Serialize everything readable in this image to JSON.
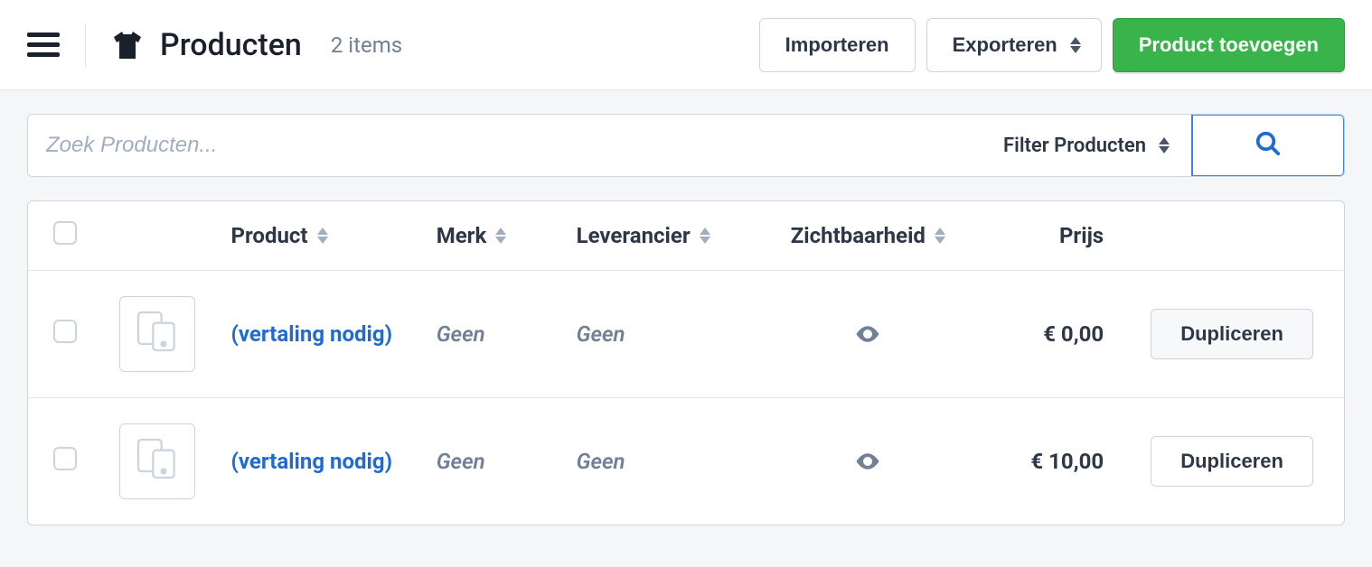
{
  "header": {
    "title": "Producten",
    "count_label": "2 items",
    "import_label": "Importeren",
    "export_label": "Exporteren",
    "add_product_label": "Product toevoegen"
  },
  "toolbar": {
    "search_placeholder": "Zoek Producten...",
    "filter_label": "Filter Producten"
  },
  "table": {
    "columns": {
      "product": "Product",
      "merk": "Merk",
      "leverancier": "Leverancier",
      "zichtbaarheid": "Zichtbaarheid",
      "prijs": "Prijs"
    },
    "rows": [
      {
        "name": "(vertaling nodig)",
        "merk": "Geen",
        "leverancier": "Geen",
        "visible": true,
        "prijs": "€ 0,00",
        "action_label": "Dupliceren"
      },
      {
        "name": "(vertaling nodig)",
        "merk": "Geen",
        "leverancier": "Geen",
        "visible": true,
        "prijs": "€ 10,00",
        "action_label": "Dupliceren"
      }
    ]
  }
}
